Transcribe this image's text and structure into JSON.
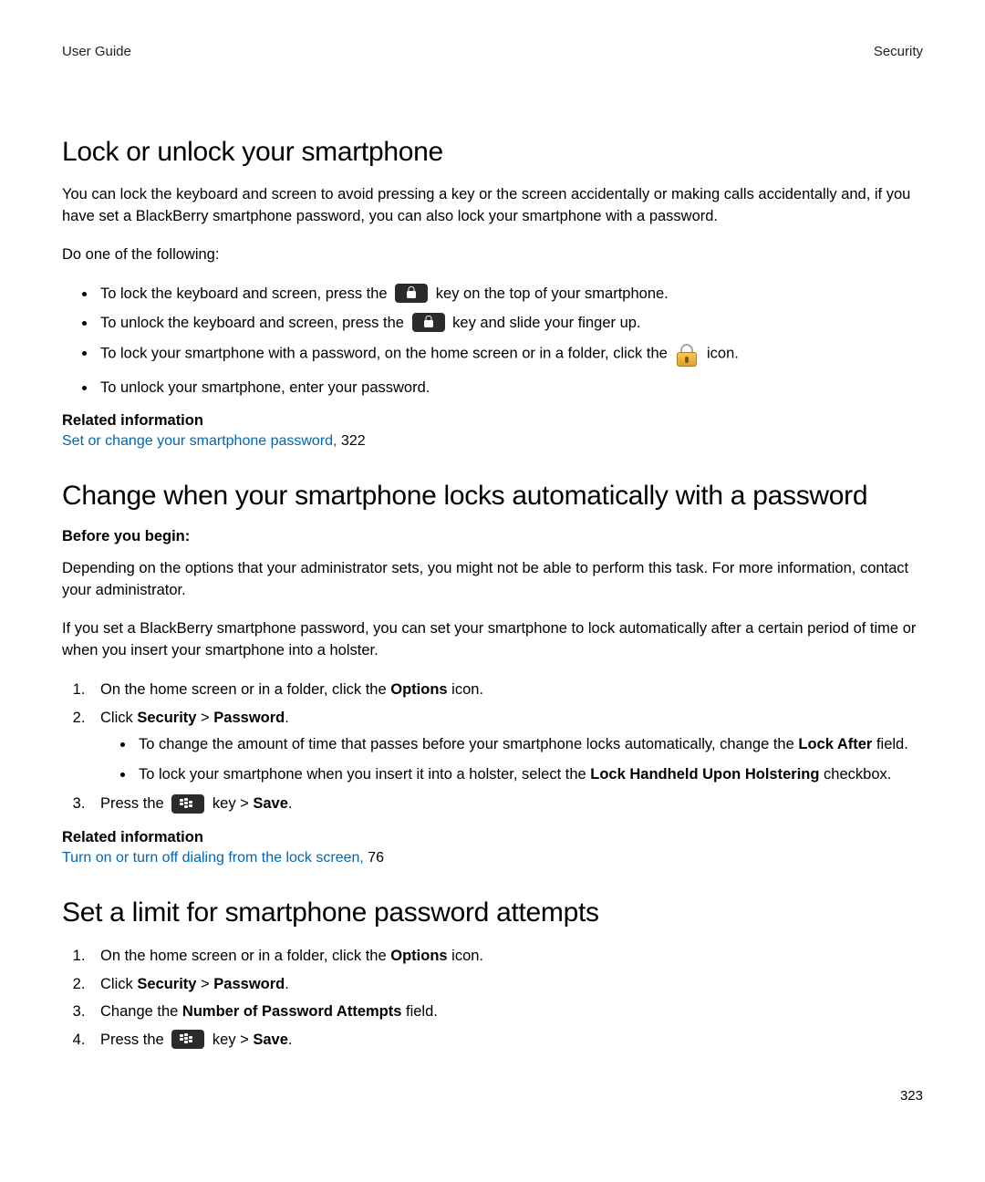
{
  "header": {
    "left": "User Guide",
    "right": "Security"
  },
  "page_number": "323",
  "s1": {
    "title": "Lock or unlock your smartphone",
    "intro": "You can lock the keyboard and screen to avoid pressing a key or the screen accidentally or making calls accidentally and, if you have set a BlackBerry smartphone password, you can also lock your smartphone with a password.",
    "lead": "Do one of the following:",
    "b1a": "To lock the keyboard and screen, press the ",
    "b1b": " key on the top of your smartphone.",
    "b2a": "To unlock the keyboard and screen, press the ",
    "b2b": " key and slide your finger up.",
    "b3a": "To lock your smartphone with a password, on the home screen or in a folder, click the ",
    "b3b": " icon.",
    "b4": "To unlock your smartphone, enter your password.",
    "related_label": "Related information",
    "related_link": "Set or change your smartphone password,",
    "related_page": " 322"
  },
  "s2": {
    "title": "Change when your smartphone locks automatically with a password",
    "before_label": "Before you begin:",
    "p1": "Depending on the options that your administrator sets, you might not be able to perform this task. For more information, contact your administrator.",
    "p2": "If you set a BlackBerry smartphone password, you can set your smartphone to lock automatically after a certain period of time or when you insert your smartphone into a holster.",
    "n1a": "On the home screen or in a folder, click the ",
    "n1_options": "Options",
    "n1b": " icon.",
    "n2a": "Click ",
    "n2_sec": "Security",
    "n2_gt": " > ",
    "n2_pwd": "Password",
    "n2b": ".",
    "sub1a": "To change the amount of time that passes before your smartphone locks automatically, change the ",
    "sub1_bold": "Lock After",
    "sub1b": " field.",
    "sub2a": "To lock your smartphone when you insert it into a holster, select the ",
    "sub2_bold": "Lock Handheld Upon Holstering",
    "sub2b": " checkbox.",
    "n3a": "Press the ",
    "n3b": " key > ",
    "n3_save": "Save",
    "n3c": ".",
    "related_label": "Related information",
    "related_link": "Turn on or turn off dialing from the lock screen,",
    "related_page": " 76"
  },
  "s3": {
    "title": "Set a limit for smartphone password attempts",
    "n1a": "On the home screen or in a folder, click the ",
    "n1_options": "Options",
    "n1b": " icon.",
    "n2a": "Click ",
    "n2_sec": "Security",
    "n2_gt": " > ",
    "n2_pwd": "Password",
    "n2b": ".",
    "n3a": "Change the ",
    "n3_bold": "Number of Password Attempts",
    "n3b": " field.",
    "n4a": "Press the ",
    "n4b": " key > ",
    "n4_save": "Save",
    "n4c": "."
  }
}
